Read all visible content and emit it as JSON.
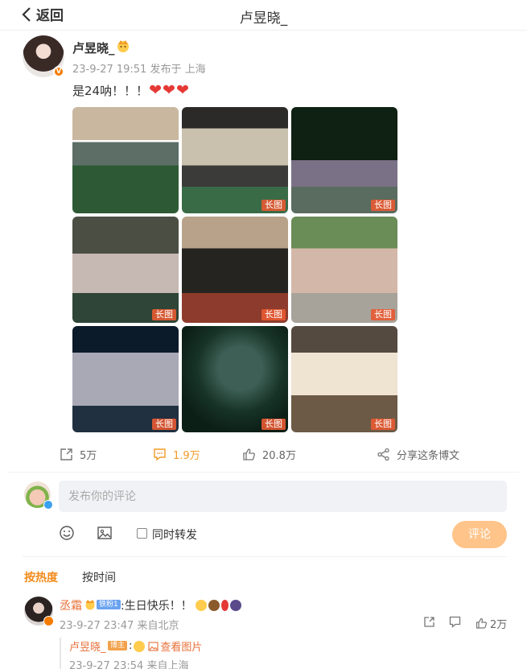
{
  "header": {
    "back_label": "返回",
    "title": "卢昱晓_"
  },
  "post": {
    "author": "卢昱晓_",
    "time": "23-9-27 19:51",
    "source": "发布于 上海",
    "text": "是24呐！！！",
    "hearts": [
      "❤",
      "❤",
      "❤"
    ],
    "image_tag": "长图",
    "images": [
      {
        "id": 1,
        "long": false
      },
      {
        "id": 2,
        "long": true
      },
      {
        "id": 3,
        "long": true
      },
      {
        "id": 4,
        "long": true
      },
      {
        "id": 5,
        "long": true
      },
      {
        "id": 6,
        "long": true
      },
      {
        "id": 7,
        "long": true
      },
      {
        "id": 8,
        "long": true
      },
      {
        "id": 9,
        "long": true
      }
    ]
  },
  "actions": {
    "repost": "5万",
    "comment": "1.9万",
    "like": "20.8万",
    "share": "分享这条博文"
  },
  "composer": {
    "placeholder": "发布你的评论",
    "forward_label": "同时转发",
    "submit_label": "评论"
  },
  "sort": {
    "hot": "按热度",
    "time": "按时间"
  },
  "comment": {
    "user": "丞霜",
    "fan_level": "铁粉1",
    "text": ":生日快乐！！",
    "time": "23-9-27 23:47",
    "source": "来自北京",
    "likes": "2万"
  },
  "reply": {
    "user": "卢昱晓_",
    "badge": "博主",
    "prefix": ":",
    "view_image": "查看图片",
    "time": "23-9-27 23:54",
    "source": "来自上海"
  },
  "colors": {
    "accent_orange": "#f28b1d",
    "heart_red": "#e53935",
    "submit_disabled": "#ffc48a",
    "name_link": "#e8703a"
  }
}
